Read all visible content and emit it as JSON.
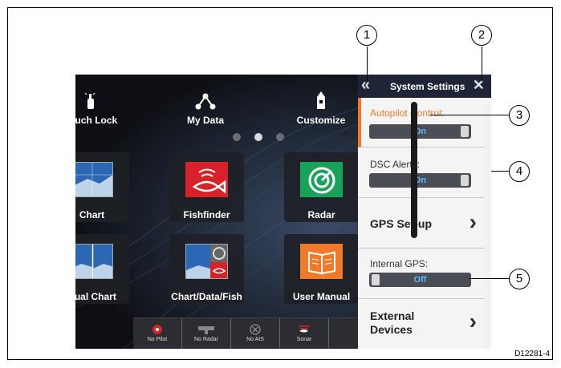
{
  "home": {
    "top_items": [
      {
        "label": "Touch Lock",
        "icon": "hand-touch-icon"
      },
      {
        "label": "My Data",
        "icon": "nodes-icon"
      },
      {
        "label": "Customize",
        "icon": "vessel-icon"
      }
    ],
    "page_dots": 3,
    "active_dot": 1,
    "tiles": [
      {
        "label": "Chart",
        "icon": "chart-icon"
      },
      {
        "label": "Fishfinder",
        "icon": "fish-icon"
      },
      {
        "label": "Radar",
        "icon": "radar-icon"
      },
      {
        "label": "Dual Chart",
        "icon": "dual-chart-icon"
      },
      {
        "label": "Chart/Data/Fish",
        "icon": "split-icon"
      },
      {
        "label": "User Manual",
        "icon": "book-icon"
      }
    ]
  },
  "status_bar": [
    {
      "label": "No Pilot",
      "icon": "pilot-icon"
    },
    {
      "label": "No Radar",
      "icon": "radar-scanner-icon"
    },
    {
      "label": "No AIS",
      "icon": "ais-icon"
    },
    {
      "label": "Sonar",
      "icon": "sonar-icon"
    }
  ],
  "panel": {
    "title": "System Settings",
    "rows": [
      {
        "label": "Autopilot Control:",
        "value": "On",
        "type": "toggle",
        "highlighted": true
      },
      {
        "label": "DSC Alerts:",
        "value": "On",
        "type": "toggle"
      },
      {
        "label": "GPS Set-up",
        "type": "nav"
      },
      {
        "label": "Internal GPS:",
        "value": "Off",
        "type": "toggle"
      },
      {
        "label_line1": "External",
        "label_line2": "Devices",
        "type": "nav"
      }
    ]
  },
  "callouts": [
    "1",
    "2",
    "3",
    "4",
    "5"
  ],
  "figure_id": "D12281-4",
  "colors": {
    "accent": "#f07a2a",
    "toggle_on": "#5ab8ff",
    "title_bar": "#1e2536"
  }
}
